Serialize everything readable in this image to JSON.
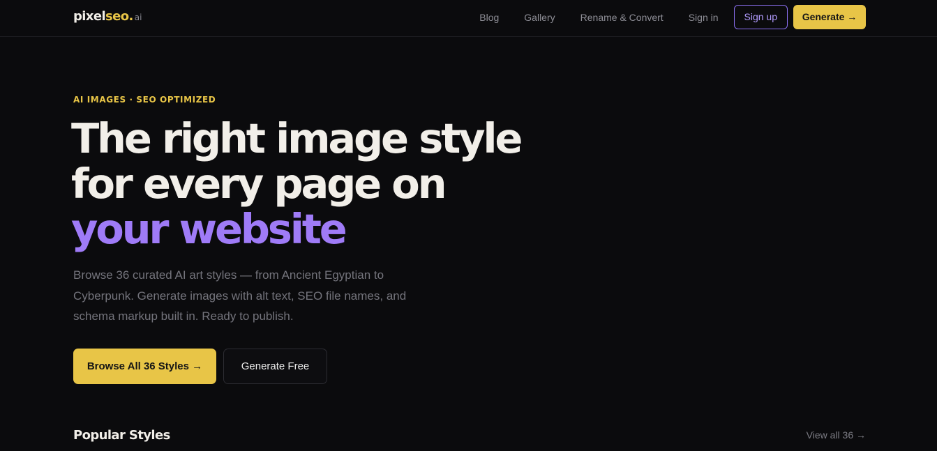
{
  "nav": {
    "logo": {
      "main": "pixel",
      "seo": "seo",
      "dot": ".",
      "tld": "ai"
    },
    "links": [
      "Blog",
      "Gallery",
      "Rename & Convert",
      "Sign in"
    ],
    "signup_label": "Sign up",
    "generate_label": "Generate →"
  },
  "hero": {
    "eyebrow": "AI IMAGES · SEO OPTIMIZED",
    "title_line1": "The right image style",
    "title_line2": "for every page on",
    "title_accent": "your website",
    "description": "Browse 36 curated AI art styles — from Ancient Egyptian to Cyberpunk. Generate images with alt text, SEO file names, and schema markup built in. Ready to publish.",
    "cta_primary": "Browse All 36 Styles →",
    "cta_secondary": "Generate Free"
  },
  "popular": {
    "title": "Popular Styles",
    "view_all": "View all 36 →"
  },
  "colors": {
    "background": "#0b0b0d",
    "accent_yellow": "#e8c547",
    "accent_purple": "#9f7bf7",
    "text_primary": "#f2efe9",
    "text_muted": "#74747c"
  }
}
